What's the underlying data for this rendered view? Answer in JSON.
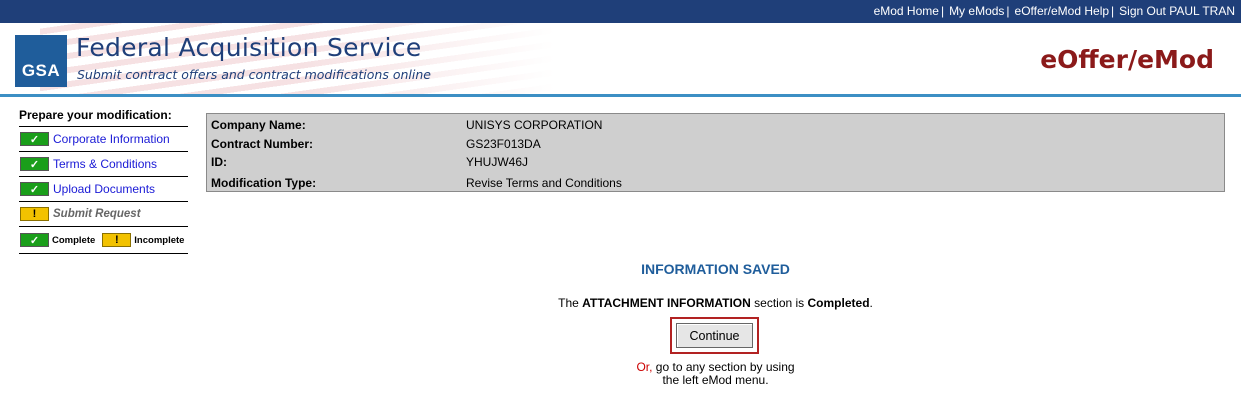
{
  "topnav": {
    "links": [
      "eMod Home",
      "My eMods",
      "eOffer/eMod Help",
      "Sign Out PAUL TRAN"
    ],
    "separator": "|"
  },
  "header": {
    "logo_text": "GSA",
    "title": "Federal Acquisition Service",
    "subtitle": "Submit contract offers and contract modifications online",
    "app_name": "eOffer/eMod"
  },
  "sidebar": {
    "heading": "Prepare your modification:",
    "items": [
      {
        "label": "Corporate Information",
        "status": "complete"
      },
      {
        "label": "Terms & Conditions",
        "status": "complete"
      },
      {
        "label": "Upload Documents",
        "status": "complete"
      },
      {
        "label": "Submit Request",
        "status": "incomplete"
      }
    ],
    "legend": {
      "complete": "Complete",
      "incomplete": "Incomplete"
    }
  },
  "info": {
    "rows": [
      {
        "label": "Company Name:",
        "value": "UNISYS CORPORATION"
      },
      {
        "label": "Contract Number:",
        "value": "GS23F013DA"
      },
      {
        "label": "ID:",
        "value": "YHUJW46J"
      },
      {
        "label": "Modification Type:",
        "value": "Revise Terms and Conditions"
      }
    ]
  },
  "main": {
    "saved_title": "INFORMATION SAVED",
    "msg_prefix": "The",
    "msg_section": "ATTACHMENT INFORMATION",
    "msg_middle": "section is",
    "msg_status": "Completed",
    "msg_end": ".",
    "continue_label": "Continue",
    "or_word": "Or,",
    "or_line1": "go to any section by using",
    "or_line2": "the left eMod menu."
  },
  "colors": {
    "topbar": "#1f3f79",
    "accent_rule": "#3c8fc4",
    "brand_red": "#8b1a1a",
    "complete_green": "#1a9e1a",
    "incomplete_yellow": "#f2c200",
    "link_blue": "#1a1ad6"
  },
  "icons": {
    "complete": "check-icon",
    "incomplete": "exclamation-icon"
  }
}
